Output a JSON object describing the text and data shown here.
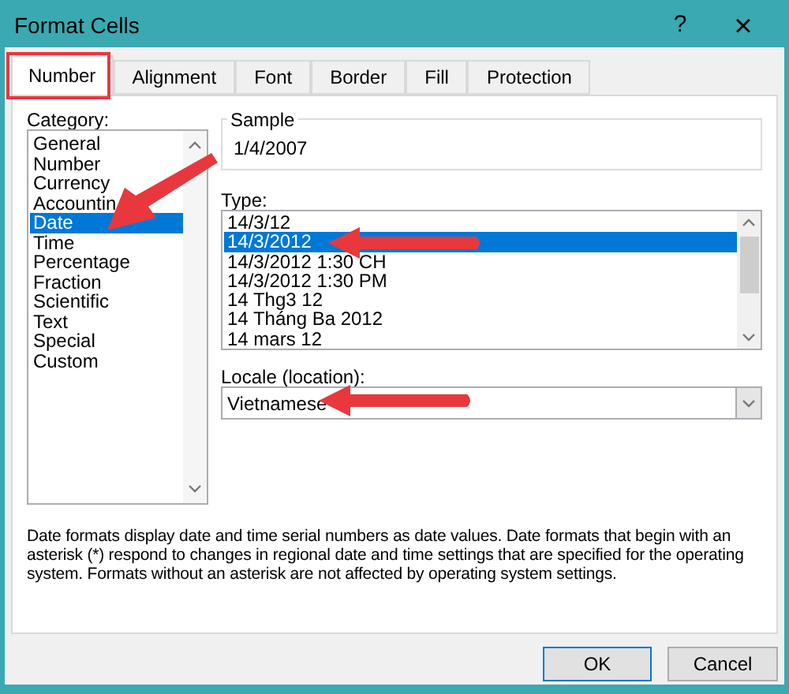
{
  "window": {
    "title": "Format Cells",
    "help": "?",
    "close": "×"
  },
  "tabs": [
    {
      "label": "Number",
      "selected": true
    },
    {
      "label": "Alignment",
      "selected": false
    },
    {
      "label": "Font",
      "selected": false
    },
    {
      "label": "Border",
      "selected": false
    },
    {
      "label": "Fill",
      "selected": false
    },
    {
      "label": "Protection",
      "selected": false
    }
  ],
  "category": {
    "label": "Category:",
    "items": [
      {
        "label": "General",
        "selected": false
      },
      {
        "label": "Number",
        "selected": false
      },
      {
        "label": "Currency",
        "selected": false
      },
      {
        "label": "Accountin",
        "selected": false
      },
      {
        "label": "Date",
        "selected": true
      },
      {
        "label": "Time",
        "selected": false
      },
      {
        "label": "Percentage",
        "selected": false
      },
      {
        "label": "Fraction",
        "selected": false
      },
      {
        "label": "Scientific",
        "selected": false
      },
      {
        "label": "Text",
        "selected": false
      },
      {
        "label": "Special",
        "selected": false
      },
      {
        "label": "Custom",
        "selected": false
      }
    ]
  },
  "sample": {
    "label": "Sample",
    "value": "1/4/2007"
  },
  "type": {
    "label": "Type:",
    "items": [
      {
        "label": "14/3/12",
        "selected": false
      },
      {
        "label": "14/3/2012",
        "selected": true
      },
      {
        "label": "14/3/2012 1:30 CH",
        "selected": false
      },
      {
        "label": "14/3/2012 1:30 PM",
        "selected": false
      },
      {
        "label": "14 Thg3 12",
        "selected": false
      },
      {
        "label": "14 Tháng Ba 2012",
        "selected": false
      },
      {
        "label": "14 mars 12",
        "selected": false
      }
    ]
  },
  "locale": {
    "label": "Locale (location):",
    "value": "Vietnamese"
  },
  "description": "Date formats display date and time serial numbers as date values.  Date formats that begin with an asterisk (*) respond to changes in regional date and time settings that are specified for the operating system. Formats without an asterisk are not affected by operating system settings.",
  "buttons": [
    "OK",
    "Cancel"
  ]
}
